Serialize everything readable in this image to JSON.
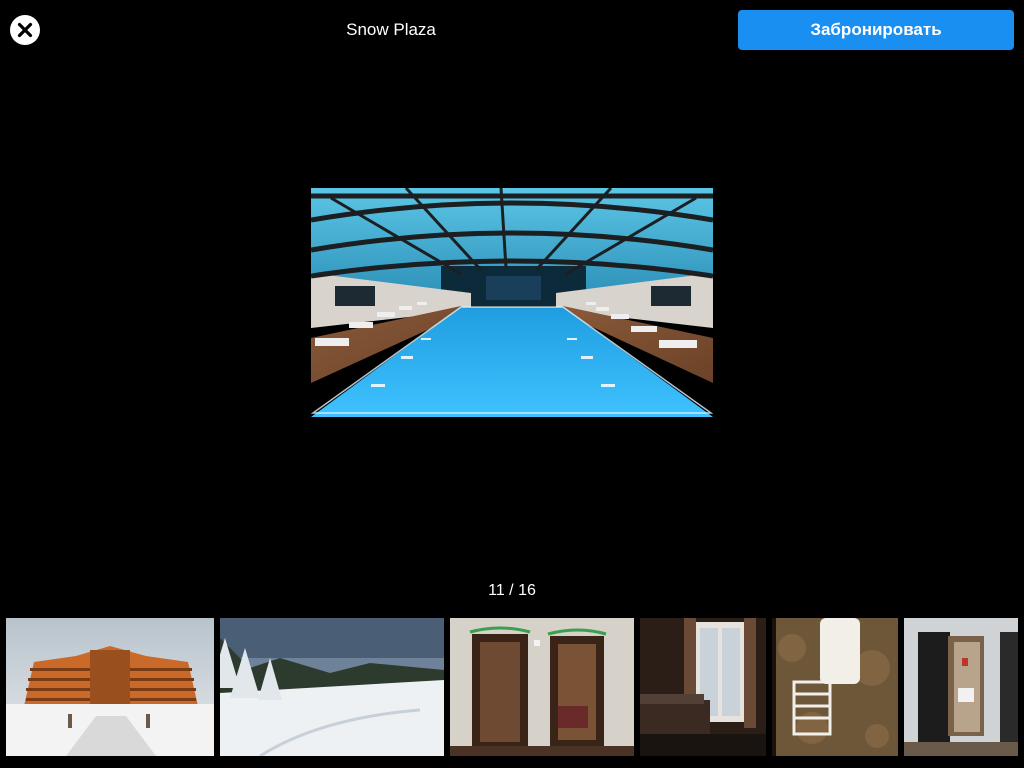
{
  "header": {
    "close_icon": "close-circle-icon",
    "title": "Snow Plaza",
    "book_label": "Забронировать",
    "book_color": "#1a8ff2"
  },
  "gallery": {
    "counter": "11 / 16",
    "current_index": 11,
    "total": 16,
    "main_photo": "indoor-pool-photo",
    "thumbnails": [
      {
        "subject": "hotel-exterior-winter-photo"
      },
      {
        "subject": "snowy-forest-landscape-photo"
      },
      {
        "subject": "room-doorways-photo"
      },
      {
        "subject": "bedroom-balcony-photo"
      },
      {
        "subject": "bathroom-water-heater-photo"
      },
      {
        "subject": "bathroom-doorway-photo"
      }
    ]
  }
}
